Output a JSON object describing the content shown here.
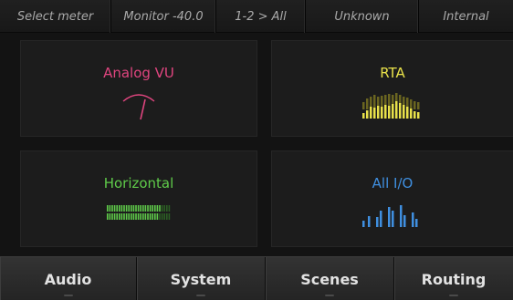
{
  "status": {
    "select": "Select meter",
    "monitor": "Monitor -40.0",
    "channels": "1-2 > All",
    "sync": "Unknown",
    "clock": "Internal"
  },
  "tiles": [
    {
      "label": "Analog VU",
      "color": "#e0457f",
      "icon": "analog-vu-needle-icon"
    },
    {
      "label": "RTA",
      "color": "#e8e14a",
      "icon": "rta-spectrum-icon"
    },
    {
      "label": "Horizontal",
      "color": "#5fcb4a",
      "icon": "horizontal-meter-icon"
    },
    {
      "label": "All I/O",
      "color": "#3f8fe0",
      "icon": "all-io-bars-icon"
    }
  ],
  "nav": [
    "Audio",
    "System",
    "Scenes",
    "Routing"
  ]
}
